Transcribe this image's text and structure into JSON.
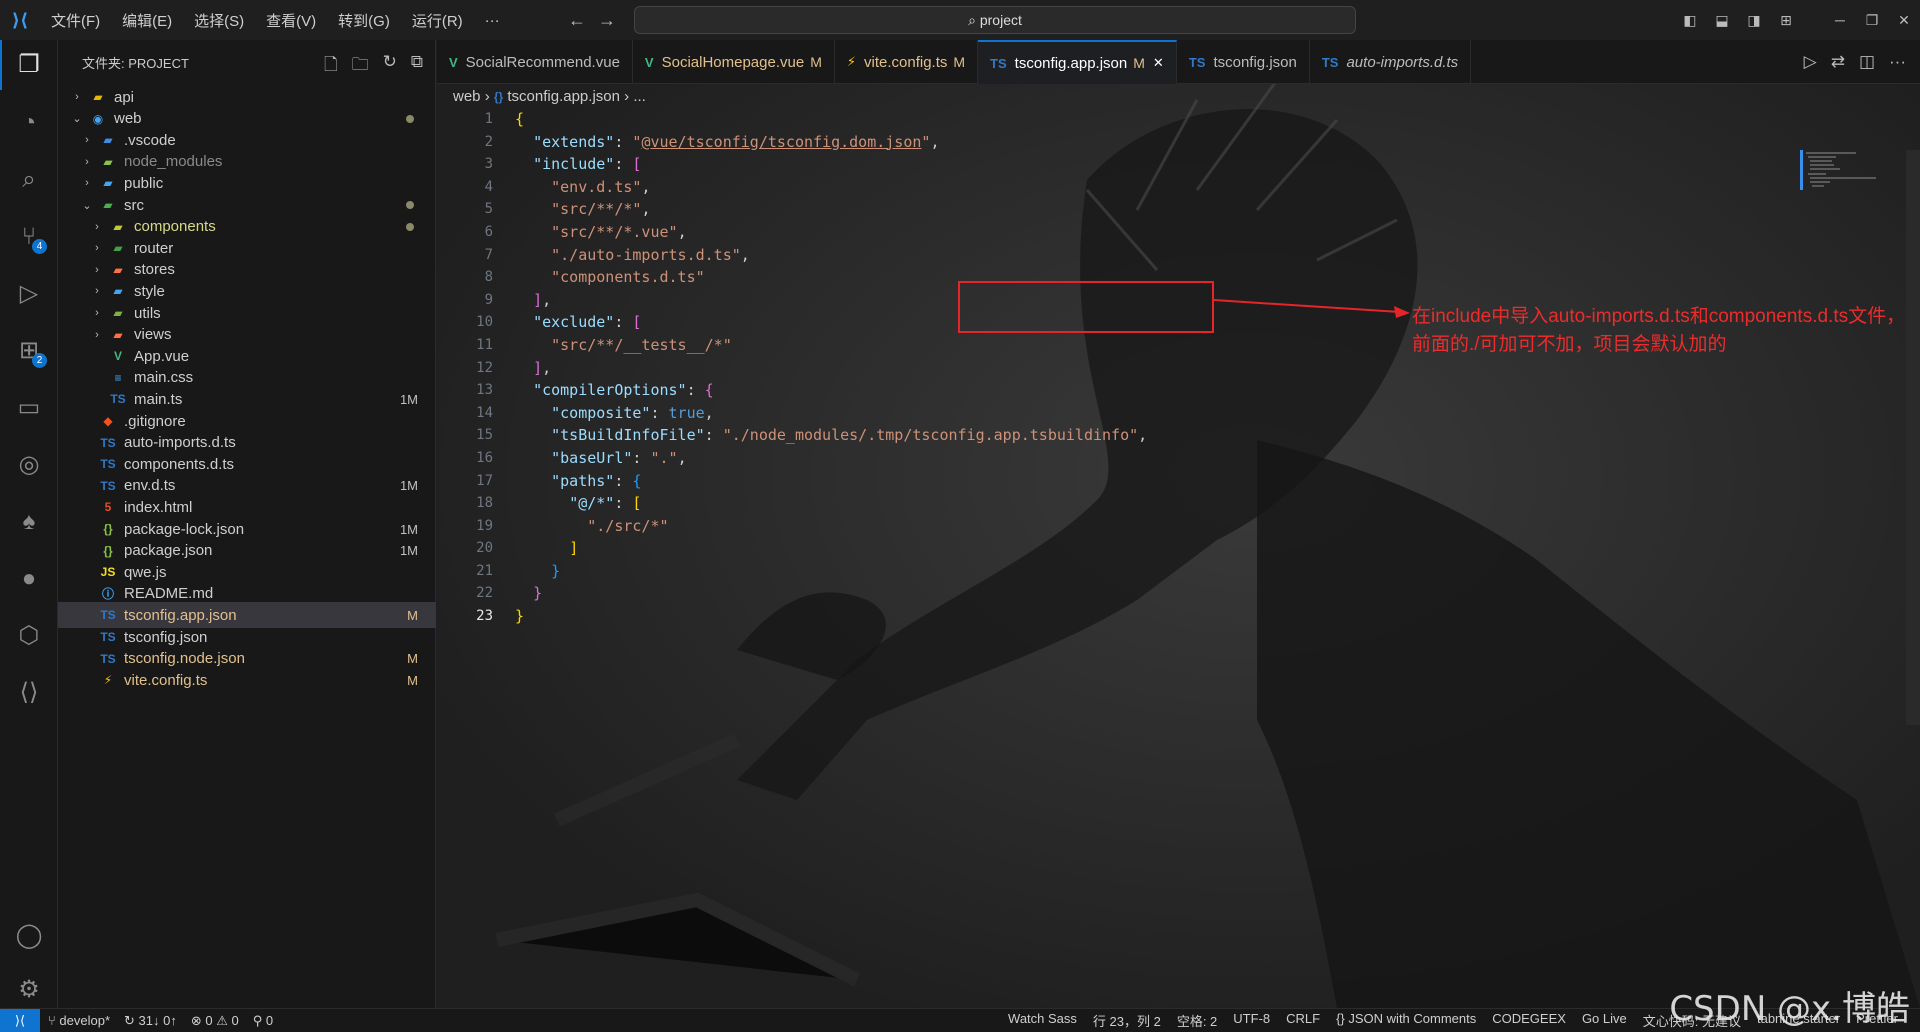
{
  "menubar": {
    "items": [
      "文件(F)",
      "编辑(E)",
      "选择(S)",
      "查看(V)",
      "转到(G)",
      "运行(R)",
      "···"
    ],
    "search": "project"
  },
  "explorer": {
    "title": "文件夹: PROJECT",
    "tree": [
      {
        "label": "api",
        "type": "folder",
        "depth": 0,
        "chev": "›",
        "icon": "folder",
        "color": "#e8b800"
      },
      {
        "label": "web",
        "type": "folder",
        "depth": 0,
        "chev": "⌄",
        "icon": "folder-web",
        "color": "#42a5f5",
        "mod": "dot"
      },
      {
        "label": ".vscode",
        "type": "folder",
        "depth": 1,
        "chev": "›",
        "icon": "folder-vscode",
        "color": "#3b8eea"
      },
      {
        "label": "node_modules",
        "type": "folder",
        "depth": 1,
        "chev": "›",
        "icon": "folder-node",
        "color": "#8bc34a",
        "dim": true
      },
      {
        "label": "public",
        "type": "folder",
        "depth": 1,
        "chev": "›",
        "icon": "folder-public",
        "color": "#42a5f5"
      },
      {
        "label": "src",
        "type": "folder",
        "depth": 1,
        "chev": "⌄",
        "icon": "folder-src",
        "color": "#4caf50",
        "mod": "dot"
      },
      {
        "label": "components",
        "type": "folder",
        "depth": 2,
        "chev": "›",
        "icon": "folder-components",
        "color": "#c0ca33",
        "mod": "dot",
        "lc": "#d7d98a"
      },
      {
        "label": "router",
        "type": "folder",
        "depth": 2,
        "chev": "›",
        "icon": "folder-router",
        "color": "#43a047"
      },
      {
        "label": "stores",
        "type": "folder",
        "depth": 2,
        "chev": "›",
        "icon": "folder-stores",
        "color": "#ff7043"
      },
      {
        "label": "style",
        "type": "folder",
        "depth": 2,
        "chev": "›",
        "icon": "folder-style",
        "color": "#42a5f5"
      },
      {
        "label": "utils",
        "type": "folder",
        "depth": 2,
        "chev": "›",
        "icon": "folder-utils",
        "color": "#7cb342"
      },
      {
        "label": "views",
        "type": "folder",
        "depth": 2,
        "chev": "›",
        "icon": "folder-views",
        "color": "#ff7043"
      },
      {
        "label": "App.vue",
        "type": "file",
        "depth": 2,
        "icon": "vue",
        "color": "#41b883"
      },
      {
        "label": "main.css",
        "type": "file",
        "depth": 2,
        "icon": "css",
        "color": "#42a5f5"
      },
      {
        "label": "main.ts",
        "type": "file",
        "depth": 2,
        "icon": "ts",
        "color": "#3178c6",
        "mod": "1M"
      },
      {
        "label": ".gitignore",
        "type": "file",
        "depth": 1,
        "icon": "git",
        "color": "#f4511e"
      },
      {
        "label": "auto-imports.d.ts",
        "type": "file",
        "depth": 1,
        "icon": "dts",
        "color": "#3178c6"
      },
      {
        "label": "components.d.ts",
        "type": "file",
        "depth": 1,
        "icon": "dts",
        "color": "#3178c6"
      },
      {
        "label": "env.d.ts",
        "type": "file",
        "depth": 1,
        "icon": "dts",
        "color": "#3178c6",
        "mod": "1M"
      },
      {
        "label": "index.html",
        "type": "file",
        "depth": 1,
        "icon": "html",
        "color": "#e44d26"
      },
      {
        "label": "package-lock.json",
        "type": "file",
        "depth": 1,
        "icon": "npm",
        "color": "#8bc34a",
        "mod": "1M"
      },
      {
        "label": "package.json",
        "type": "file",
        "depth": 1,
        "icon": "npm",
        "color": "#8bc34a",
        "mod": "1M"
      },
      {
        "label": "qwe.js",
        "type": "file",
        "depth": 1,
        "icon": "js",
        "color": "#f7df1e"
      },
      {
        "label": "README.md",
        "type": "file",
        "depth": 1,
        "icon": "info",
        "color": "#42a5f5"
      },
      {
        "label": "tsconfig.app.json",
        "type": "file",
        "depth": 1,
        "icon": "tsconfig",
        "color": "#3178c6",
        "mod": "M",
        "selected": true,
        "lc": "#e2c08d"
      },
      {
        "label": "tsconfig.json",
        "type": "file",
        "depth": 1,
        "icon": "tsconfig",
        "color": "#3178c6"
      },
      {
        "label": "tsconfig.node.json",
        "type": "file",
        "depth": 1,
        "icon": "tsconfig",
        "color": "#3178c6",
        "mod": "M",
        "lc": "#e2c08d"
      },
      {
        "label": "vite.config.ts",
        "type": "file",
        "depth": 1,
        "icon": "vite",
        "color": "#ffc107",
        "mod": "M",
        "lc": "#e2c08d"
      }
    ]
  },
  "tabs": [
    {
      "label": "SocialRecommend.vue",
      "icon": "vue",
      "color": "#41b883",
      "mod": ""
    },
    {
      "label": "SocialHomepage.vue",
      "icon": "vue",
      "color": "#41b883",
      "mod": "M"
    },
    {
      "label": "vite.config.ts",
      "icon": "vite",
      "color": "#ffc107",
      "mod": "M"
    },
    {
      "label": "tsconfig.app.json",
      "icon": "tsconfig",
      "color": "#3178c6",
      "mod": "M",
      "active": true
    },
    {
      "label": "tsconfig.json",
      "icon": "tsconfig",
      "color": "#3178c6",
      "mod": ""
    },
    {
      "label": "auto-imports.d.ts",
      "icon": "dts",
      "color": "#3178c6",
      "mod": "",
      "italic": true
    }
  ],
  "breadcrumb": {
    "folder": "web",
    "file": "tsconfig.app.json",
    "rest": "..."
  },
  "code": {
    "lines": [
      [
        [
          "b1",
          "{"
        ]
      ],
      [
        [
          "p",
          "  "
        ],
        [
          "k",
          "\"extends\""
        ],
        [
          "p",
          ": "
        ],
        [
          "s",
          "\""
        ],
        [
          "su",
          "@vue/tsconfig/tsconfig.dom.json"
        ],
        [
          "s",
          "\""
        ],
        [
          "p",
          ","
        ]
      ],
      [
        [
          "p",
          "  "
        ],
        [
          "k",
          "\"include\""
        ],
        [
          "p",
          ": "
        ],
        [
          "b2",
          "["
        ]
      ],
      [
        [
          "p",
          "    "
        ],
        [
          "s",
          "\"env.d.ts\""
        ],
        [
          "p",
          ","
        ]
      ],
      [
        [
          "p",
          "    "
        ],
        [
          "s",
          "\"src/**/*\""
        ],
        [
          "p",
          ","
        ]
      ],
      [
        [
          "p",
          "    "
        ],
        [
          "s",
          "\"src/**/*.vue\""
        ],
        [
          "p",
          ","
        ]
      ],
      [
        [
          "p",
          "    "
        ],
        [
          "s",
          "\"./auto-imports.d.ts\""
        ],
        [
          "p",
          ","
        ]
      ],
      [
        [
          "p",
          "    "
        ],
        [
          "s",
          "\"components.d.ts\""
        ]
      ],
      [
        [
          "p",
          "  "
        ],
        [
          "b2",
          "]"
        ],
        [
          "p",
          ","
        ]
      ],
      [
        [
          "p",
          "  "
        ],
        [
          "k",
          "\"exclude\""
        ],
        [
          "p",
          ": "
        ],
        [
          "b2",
          "["
        ]
      ],
      [
        [
          "p",
          "    "
        ],
        [
          "s",
          "\"src/**/__tests__/*\""
        ]
      ],
      [
        [
          "p",
          "  "
        ],
        [
          "b2",
          "]"
        ],
        [
          "p",
          ","
        ]
      ],
      [
        [
          "p",
          "  "
        ],
        [
          "k",
          "\"compilerOptions\""
        ],
        [
          "p",
          ": "
        ],
        [
          "b2",
          "{"
        ]
      ],
      [
        [
          "p",
          "    "
        ],
        [
          "k",
          "\"composite\""
        ],
        [
          "p",
          ": "
        ],
        [
          "kw",
          "true"
        ],
        [
          "p",
          ","
        ]
      ],
      [
        [
          "p",
          "    "
        ],
        [
          "k",
          "\"tsBuildInfoFile\""
        ],
        [
          "p",
          ": "
        ],
        [
          "s",
          "\"./node_modules/.tmp/tsconfig.app.tsbuildinfo\""
        ],
        [
          "p",
          ","
        ]
      ],
      [
        [
          "p",
          "    "
        ],
        [
          "k",
          "\"baseUrl\""
        ],
        [
          "p",
          ": "
        ],
        [
          "s",
          "\".\""
        ],
        [
          "p",
          ","
        ]
      ],
      [
        [
          "p",
          "    "
        ],
        [
          "k",
          "\"paths\""
        ],
        [
          "p",
          ": "
        ],
        [
          "b3",
          "{"
        ]
      ],
      [
        [
          "p",
          "      "
        ],
        [
          "k",
          "\"@/*\""
        ],
        [
          "p",
          ": "
        ],
        [
          "b1",
          "["
        ]
      ],
      [
        [
          "p",
          "        "
        ],
        [
          "s",
          "\"./src/*\""
        ]
      ],
      [
        [
          "p",
          "      "
        ],
        [
          "b1",
          "]"
        ]
      ],
      [
        [
          "p",
          "    "
        ],
        [
          "b3",
          "}"
        ]
      ],
      [
        [
          "p",
          "  "
        ],
        [
          "b2",
          "}"
        ]
      ],
      [
        [
          "b1",
          "}"
        ]
      ]
    ],
    "current_line": 23
  },
  "annotation": {
    "line1": "在include中导入auto-imports.d.ts和components.d.ts文件，",
    "line2": "前面的./可加可不加，项目会默认加的"
  },
  "status": {
    "branch": "develop*",
    "sync": "31↓ 0↑",
    "problems_errors": "0",
    "problems_warnings": "0",
    "ports": "0",
    "right": [
      "Watch Sass",
      "行 23，列 2",
      "空格: 2",
      "UTF-8",
      "CRLF",
      "{} JSON with Comments",
      "CODEGEEX",
      "Go Live",
      "文心快码: 无建议",
      "tabnine starter",
      "Prettier"
    ]
  },
  "watermark": "CSDN @x.博皓",
  "colors": {
    "accent": "#0e74d0",
    "annotation": "#e5252a"
  }
}
